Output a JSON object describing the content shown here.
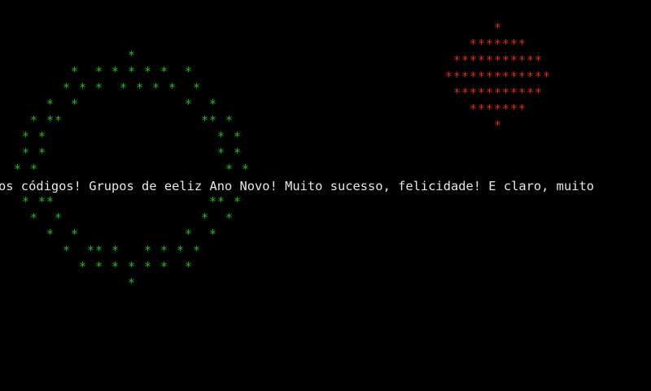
{
  "terminal": {
    "background": "#000000",
    "scrolling_text": "os códigos! Grupos de eeliz Ano Novo! Muito sucesso, felicidade! E claro, muito",
    "text_color": "#e6e6e6"
  },
  "wreath": {
    "glyph": "*",
    "color": "#22bb22"
  },
  "ornament": {
    "glyph": "*",
    "color": "#e02a1a"
  }
}
